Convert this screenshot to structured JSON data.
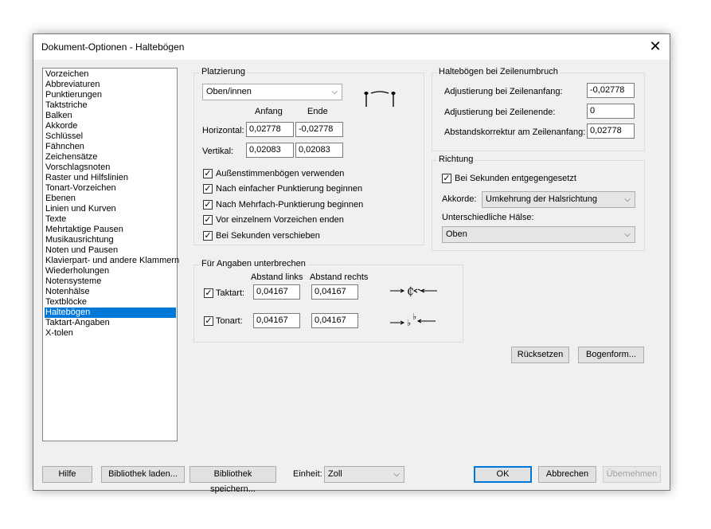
{
  "window": {
    "title": "Dokument-Optionen - Haltebögen",
    "close_glyph": "✕"
  },
  "sidebar": {
    "items": [
      "Vorzeichen",
      "Abbreviaturen",
      "Punktierungen",
      "Taktstriche",
      "Balken",
      "Akkorde",
      "Schlüssel",
      "Fähnchen",
      "Zeichensätze",
      "Vorschlagsnoten",
      "Raster und Hilfslinien",
      "Tonart-Vorzeichen",
      "Ebenen",
      "Linien und Kurven",
      "Texte",
      "Mehrtaktige Pausen",
      "Musikausrichtung",
      "Noten und Pausen",
      "Klavierpart- und andere Klammern",
      "Wiederholungen",
      "Notensysteme",
      "Notenhälse",
      "Textblöcke",
      "Haltebögen",
      "Taktart-Angaben",
      "X-tolen"
    ],
    "selected": "Haltebögen"
  },
  "platzierung": {
    "label": "Platzierung",
    "select_value": "Oben/innen",
    "col_anfang": "Anfang",
    "col_ende": "Ende",
    "horizontal_label": "Horizontal:",
    "horizontal_anfang": "0,02778",
    "horizontal_ende": "-0,02778",
    "vertikal_label": "Vertikal:",
    "vertikal_anfang": "0,02083",
    "vertikal_ende": "0,02083",
    "checks": [
      {
        "label": "Außenstimmenbögen verwenden",
        "checked": true
      },
      {
        "label": "Nach einfacher Punktierung beginnen",
        "checked": true
      },
      {
        "label": "Nach Mehrfach-Punktierung beginnen",
        "checked": true
      },
      {
        "label": "Vor einzelnem Vorzeichen enden",
        "checked": true
      },
      {
        "label": "Bei Sekunden verschieben",
        "checked": true
      }
    ]
  },
  "zeilenumbruch": {
    "label": "Haltebögen bei Zeilenumbruch",
    "anfang_label": "Adjustierung bei Zeilenanfang:",
    "anfang_value": "-0,02778",
    "ende_label": "Adjustierung bei Zeilenende:",
    "ende_value": "0",
    "abstand_label": "Abstandskorrektur am Zeilenanfang:",
    "abstand_value": "0,02778"
  },
  "richtung": {
    "label": "Richtung",
    "sekunden_label": "Bei Sekunden entgegengesetzt",
    "sekunden_checked": true,
    "akkorde_label": "Akkorde:",
    "akkorde_value": "Umkehrung der Halsrichtung",
    "haelse_label": "Unterschiedliche Hälse:",
    "haelse_value": "Oben"
  },
  "unterbrechen": {
    "label": "Für Angaben unterbrechen",
    "col_links": "Abstand links",
    "col_rechts": "Abstand rechts",
    "taktart_label": "Taktart:",
    "taktart_checked": true,
    "taktart_links": "0,04167",
    "taktart_rechts": "0,04167",
    "tonart_label": "Tonart:",
    "tonart_checked": true,
    "tonart_links": "0,04167",
    "tonart_rechts": "0,04167"
  },
  "actions": {
    "ruecksetzen": "Rücksetzen",
    "bogenform": "Bogenform..."
  },
  "footer": {
    "hilfe": "Hilfe",
    "bibliothek_laden": "Bibliothek laden...",
    "bibliothek_speichern": "Bibliothek speichern...",
    "einheit_label": "Einheit:",
    "einheit_value": "Zoll",
    "ok": "OK",
    "abbrechen": "Abbrechen",
    "uebernehmen": "Übernehmen"
  },
  "colors": {
    "accent": "#0078d7",
    "dialog_bg": "#f0f0f0"
  }
}
